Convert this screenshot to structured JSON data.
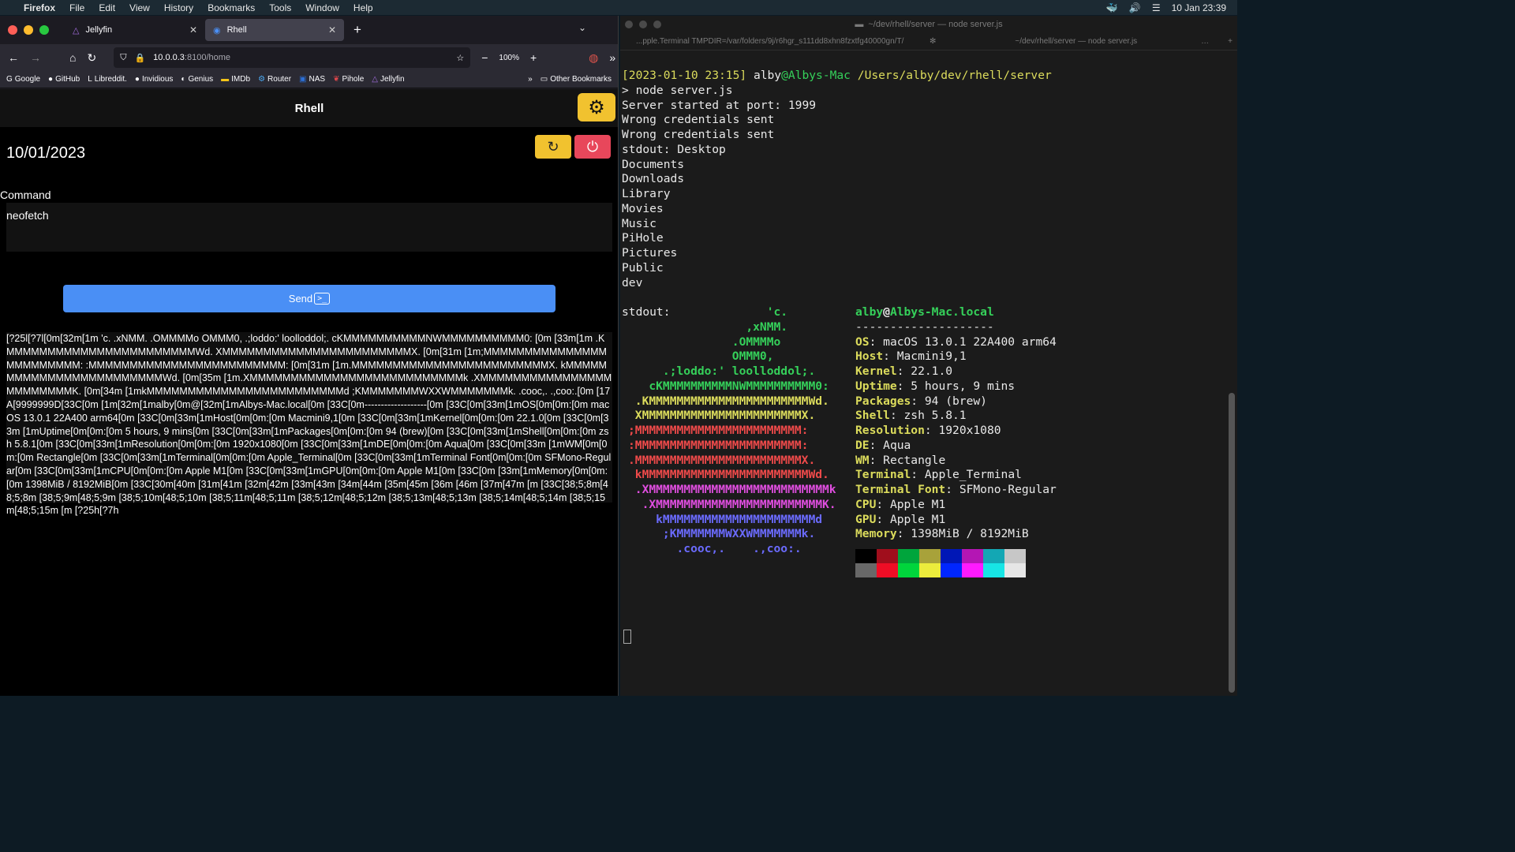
{
  "menubar": {
    "app": "Firefox",
    "items": [
      "File",
      "Edit",
      "View",
      "History",
      "Bookmarks",
      "Tools",
      "Window",
      "Help"
    ],
    "datetime": "10 Jan  23:39"
  },
  "firefox": {
    "tabs": [
      {
        "title": "Jellyfin"
      },
      {
        "title": "Rhell"
      }
    ],
    "url_host": "10.0.0.3",
    "url_path": ":8100/home",
    "zoom": "100%",
    "bookmarks": [
      "Google",
      "GitHub",
      "Libreddit.",
      "Invidious",
      "Genius",
      "IMDb",
      "Router",
      "NAS",
      "Pihole",
      "Jellyfin"
    ],
    "other_bookmarks": "Other Bookmarks"
  },
  "rhell": {
    "title": "Rhell",
    "date": "10/01/2023",
    "command_label": "Command",
    "command_value": "neofetch",
    "send_label": "Send",
    "send_icon_text": ">_",
    "output": "[?25l[?7l[0m[32m[1m 'c. .xNMM. .OMMMMo OMMM0, .;loddo:' loolloddol;. cKMMMMMMMMMMNWMMMMMMMMMM0: [0m [33m[1m .KMMMMMMMMMMMMMMMMMMMMMMMWd. XMMMMMMMMMMMMMMMMMMMMMMMX. [0m[31m [1m;MMMMMMMMMMMMMMMMMMMMMMMM: :MMMMMMMMMMMMMMMMMMMMMMMM: [0m[31m [1m.MMMMMMMMMMMMMMMMMMMMMMMMX. kMMMMMMMMMMMMMMMMMMMMMMMMWd. [0m[35m [1m.XMMMMMMMMMMMMMMMMMMMMMMMMMMk .XMMMMMMMMMMMMMMMMMMMMMMMMK. [0m[34m [1mkMMMMMMMMMMMMMMMMMMMMMMMMd ;KMMMMMMMWXXWMMMMMMMk. .cooc,. .,coo:.[0m [17A[9999999D[33C[0m [1m[32m[1malby[0m@[32m[1mAlbys-Mac.local[0m [33C[0m-------------------[0m [33C[0m[33m[1mOS[0m[0m:[0m macOS 13.0.1 22A400 arm64[0m [33C[0m[33m[1mHost[0m[0m:[0m Macmini9,1[0m [33C[0m[33m[1mKernel[0m[0m:[0m 22.1.0[0m [33C[0m[33m [1mUptime[0m[0m:[0m 5 hours, 9 mins[0m [33C[0m[33m[1mPackages[0m[0m:[0m 94 (brew)[0m [33C[0m[33m[1mShell[0m[0m:[0m zsh 5.8.1[0m [33C[0m[33m[1mResolution[0m[0m:[0m 1920x1080[0m [33C[0m[33m[1mDE[0m[0m:[0m Aqua[0m [33C[0m[33m [1mWM[0m[0m:[0m Rectangle[0m [33C[0m[33m[1mTerminal[0m[0m:[0m Apple_Terminal[0m [33C[0m[33m[1mTerminal Font[0m[0m:[0m SFMono-Regular[0m [33C[0m[33m[1mCPU[0m[0m:[0m Apple M1[0m [33C[0m[33m[1mGPU[0m[0m:[0m Apple M1[0m [33C[0m [33m[1mMemory[0m[0m:[0m 1398MiB / 8192MiB[0m [33C[30m[40m [31m[41m [32m[42m [33m[43m [34m[44m [35m[45m [36m [46m [37m[47m [m [33C[38;5;8m[48;5;8m [38;5;9m[48;5;9m [38;5;10m[48;5;10m [38;5;11m[48;5;11m [38;5;12m[48;5;12m [38;5;13m[48;5;13m [38;5;14m[48;5;14m [38;5;15m[48;5;15m [m [?25h[?7h"
  },
  "terminal": {
    "title": "~/dev/rhell/server — node server.js",
    "tab1": "...pple.Terminal TMPDIR=/var/folders/9j/r6hgr_s111dd8xhn8fzxtfg40000gn/T/",
    "tab2": "~/dev/rhell/server — node server.js",
    "prompt_time": "[2023-01-10 23:15]",
    "prompt_user": "alby",
    "prompt_host": "@Albys-Mac",
    "prompt_path": "/Users/alby/dev/rhell/server",
    "command": "> node server.js",
    "log": [
      "Server started at port: 1999",
      "Wrong credentials sent",
      "Wrong credentials sent",
      "stdout: Desktop",
      "Documents",
      "Downloads",
      "Library",
      "Movies",
      "Music",
      "PiHole",
      "Pictures",
      "Public",
      "dev"
    ],
    "stdout2": "stdout:",
    "logo": [
      "                    'c.",
      "                 ,xNMM.",
      "               .OMMMMo",
      "               OMMM0,",
      "     .;loddo:' loolloddol;.",
      "   cKMMMMMMMMMMNWMMMMMMMMMM0:",
      " .KMMMMMMMMMMMMMMMMMMMMMMMWd.",
      " XMMMMMMMMMMMMMMMMMMMMMMMX.",
      ";MMMMMMMMMMMMMMMMMMMMMMMM:",
      ":MMMMMMMMMMMMMMMMMMMMMMMM:",
      ".MMMMMMMMMMMMMMMMMMMMMMMMX.",
      " kMMMMMMMMMMMMMMMMMMMMMMMMWd.",
      " .XMMMMMMMMMMMMMMMMMMMMMMMMMMk",
      "  .XMMMMMMMMMMMMMMMMMMMMMMMMK.",
      "    kMMMMMMMMMMMMMMMMMMMMMMd",
      "     ;KMMMMMMMWXXWMMMMMMMk.",
      "       .cooc,.    .,coo:."
    ],
    "logo_colors": [
      "#35d05a",
      "#35d05a",
      "#35d05a",
      "#35d05a",
      "#35d05a",
      "#35d05a",
      "#dcdc5c",
      "#dcdc5c",
      "#ef4a4a",
      "#ef4a4a",
      "#ef4a4a",
      "#ef4a4a",
      "#e04ee0",
      "#e04ee0",
      "#6b6bff",
      "#6b6bff",
      "#6b6bff"
    ],
    "info_user": "alby",
    "info_at": "@",
    "info_host": "Albys-Mac.local",
    "info_sep": "--------------------",
    "info": [
      {
        "k": "OS",
        "v": " macOS 13.0.1 22A400 arm64"
      },
      {
        "k": "Host",
        "v": " Macmini9,1"
      },
      {
        "k": "Kernel",
        "v": " 22.1.0"
      },
      {
        "k": "Uptime",
        "v": " 5 hours, 9 mins"
      },
      {
        "k": "Packages",
        "v": " 94 (brew)"
      },
      {
        "k": "Shell",
        "v": " zsh 5.8.1"
      },
      {
        "k": "Resolution",
        "v": " 1920x1080"
      },
      {
        "k": "DE",
        "v": " Aqua"
      },
      {
        "k": "WM",
        "v": " Rectangle"
      },
      {
        "k": "Terminal",
        "v": " Apple_Terminal"
      },
      {
        "k": "Terminal Font",
        "v": " SFMono-Regular"
      },
      {
        "k": "CPU",
        "v": " Apple M1"
      },
      {
        "k": "GPU",
        "v": " Apple M1"
      },
      {
        "k": "Memory",
        "v": " 1398MiB / 8192MiB"
      }
    ],
    "palette_row1": [
      "#000000",
      "#a00e1c",
      "#00a53c",
      "#a8a23a",
      "#0017b6",
      "#b416b4",
      "#13a7b4",
      "#c7c7c7"
    ],
    "palette_row2": [
      "#686868",
      "#ef0d25",
      "#00d53c",
      "#ecec3c",
      "#0026ff",
      "#ff1aff",
      "#17e5e5",
      "#e6e6e6"
    ]
  }
}
